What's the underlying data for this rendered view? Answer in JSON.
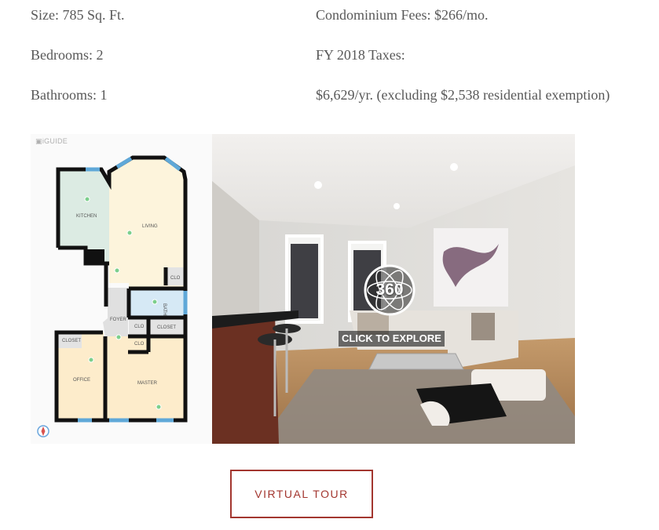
{
  "facts": {
    "size": "Size: 785 Sq. Ft.",
    "bedrooms": "Bedrooms: 2",
    "bathrooms": "Bathrooms: 1",
    "condo_fees": "Condominium Fees: $266/mo.",
    "taxes_label": "FY 2018 Taxes:",
    "taxes_value": "$6,629/yr. (excluding $2,538 residential exemption)"
  },
  "tour": {
    "brand": "iGUIDE",
    "badge": "360",
    "explore_label": "CLICK TO EXPLORE",
    "rooms": {
      "kitchen": "KITCHEN",
      "living": "LIVING",
      "bath": "BATH",
      "foyer": "FOYER",
      "clo": "CLO",
      "closet": "CLOSET",
      "office": "OFFICE",
      "master": "MASTER"
    }
  },
  "button": {
    "label": "VIRTUAL TOUR"
  },
  "colors": {
    "accent": "#a3362f",
    "text": "#585858"
  }
}
